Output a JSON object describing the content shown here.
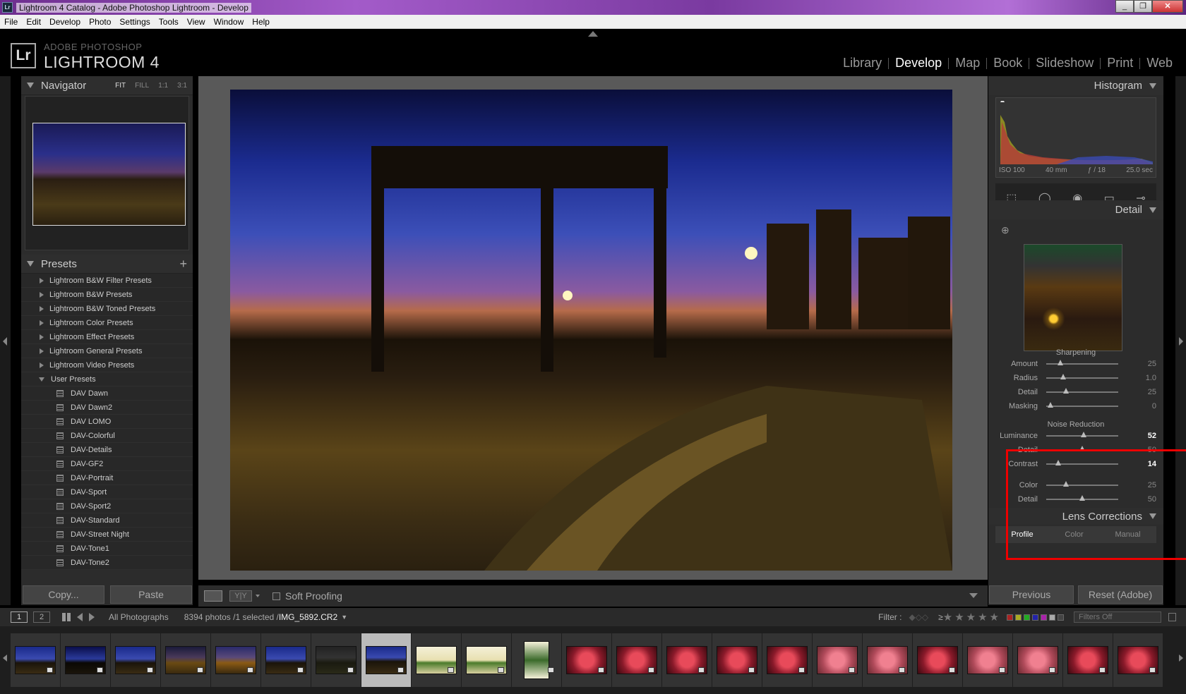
{
  "window": {
    "title": "Lightroom 4 Catalog - Adobe Photoshop Lightroom - Develop",
    "icon": "Lr"
  },
  "menu": [
    "File",
    "Edit",
    "Develop",
    "Photo",
    "Settings",
    "Tools",
    "View",
    "Window",
    "Help"
  ],
  "brand": {
    "logo": "Lr",
    "line1": "ADOBE PHOTOSHOP",
    "line2": "LIGHTROOM 4"
  },
  "modules": [
    "Library",
    "Develop",
    "Map",
    "Book",
    "Slideshow",
    "Print",
    "Web"
  ],
  "active_module": "Develop",
  "navigator": {
    "title": "Navigator",
    "options": [
      "FIT",
      "FILL",
      "1:1",
      "3:1"
    ]
  },
  "presets": {
    "title": "Presets",
    "add": "+",
    "folders": [
      "Lightroom B&W Filter Presets",
      "Lightroom B&W Presets",
      "Lightroom B&W Toned Presets",
      "Lightroom Color Presets",
      "Lightroom Effect Presets",
      "Lightroom General Presets",
      "Lightroom Video Presets"
    ],
    "user_folder": "User Presets",
    "user_items": [
      "DAV Dawn",
      "DAV Dawn2",
      "DAV LOMO",
      "DAV-Colorful",
      "DAV-Details",
      "DAV-GF2",
      "DAV-Portrait",
      "DAV-Sport",
      "DAV-Sport2",
      "DAV-Standard",
      "DAV-Street Night",
      "DAV-Tone1",
      "DAV-Tone2"
    ]
  },
  "left_buttons": {
    "copy": "Copy...",
    "paste": "Paste"
  },
  "toolbar": {
    "yy": "Y|Y",
    "soft_proofing": "Soft Proofing"
  },
  "histogram": {
    "title": "Histogram",
    "iso": "ISO 100",
    "focal": "40 mm",
    "aperture": "ƒ / 18",
    "shutter": "25.0 sec"
  },
  "detail": {
    "title": "Detail",
    "sharpening": {
      "title": "Sharpening",
      "rows": [
        {
          "label": "Amount",
          "value": "25",
          "pos": 0.2
        },
        {
          "label": "Radius",
          "value": "1.0",
          "pos": 0.24
        },
        {
          "label": "Detail",
          "value": "25",
          "pos": 0.27
        },
        {
          "label": "Masking",
          "value": "0",
          "pos": 0.06
        }
      ]
    },
    "noise": {
      "title": "Noise Reduction",
      "rows": [
        {
          "label": "Luminance",
          "value": "52",
          "pos": 0.52,
          "hi": true
        },
        {
          "label": "Detail",
          "value": "50",
          "pos": 0.5,
          "hi": false
        },
        {
          "label": "Contrast",
          "value": "14",
          "pos": 0.17,
          "hi": true
        }
      ],
      "color_rows": [
        {
          "label": "Color",
          "value": "25",
          "pos": 0.27,
          "hi": false
        },
        {
          "label": "Detail",
          "value": "50",
          "pos": 0.5,
          "hi": false
        }
      ]
    }
  },
  "lens": {
    "title": "Lens Corrections",
    "tabs": [
      "Profile",
      "Color",
      "Manual"
    ]
  },
  "right_buttons": {
    "previous": "Previous",
    "reset": "Reset (Adobe)"
  },
  "filmstrip": {
    "views": [
      "1",
      "2"
    ],
    "source": "All Photographs",
    "count": "8394 photos /1 selected /",
    "filename": "IMG_5892.CR2",
    "filter_label": "Filter :",
    "gte": "≥",
    "stars": "★★★★★",
    "filters_off": "Filters Off"
  },
  "thumbs": [
    "night1",
    "night2",
    "night1",
    "dusk1",
    "dusk2",
    "night1",
    "night3",
    "sel",
    "can",
    "can",
    "can2",
    "red",
    "red",
    "red",
    "red",
    "red",
    "pink",
    "pink",
    "red",
    "pink",
    "pink",
    "red",
    "red"
  ]
}
